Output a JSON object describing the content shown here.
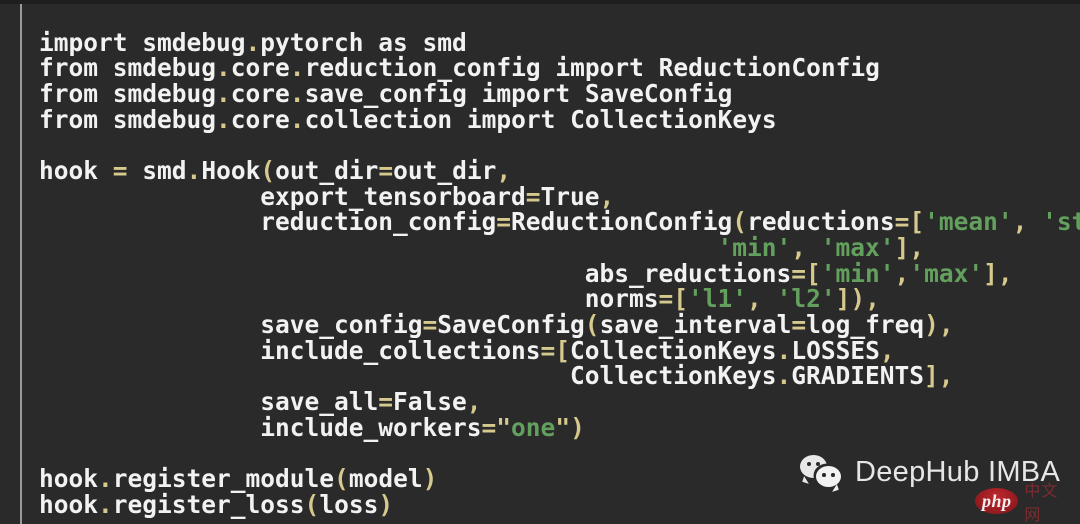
{
  "editor": {
    "background_color": "#2a2a2a",
    "text_color": "#f2f2f2",
    "punctuation_color": "#d5c98d",
    "string_color": "#63a05e",
    "rule_color": "#9a9a9a",
    "language": "python",
    "lines": [
      [
        {
          "t": "import smdebug",
          "c": "id"
        },
        {
          "t": ".",
          "c": "punc"
        },
        {
          "t": "pytorch as smd",
          "c": "id"
        }
      ],
      [
        {
          "t": "from smdebug",
          "c": "id"
        },
        {
          "t": ".",
          "c": "punc"
        },
        {
          "t": "core",
          "c": "id"
        },
        {
          "t": ".",
          "c": "punc"
        },
        {
          "t": "reduction_config import ReductionConfig",
          "c": "id"
        }
      ],
      [
        {
          "t": "from smdebug",
          "c": "id"
        },
        {
          "t": ".",
          "c": "punc"
        },
        {
          "t": "core",
          "c": "id"
        },
        {
          "t": ".",
          "c": "punc"
        },
        {
          "t": "save_config import SaveConfig",
          "c": "id"
        }
      ],
      [
        {
          "t": "from smdebug",
          "c": "id"
        },
        {
          "t": ".",
          "c": "punc"
        },
        {
          "t": "core",
          "c": "id"
        },
        {
          "t": ".",
          "c": "punc"
        },
        {
          "t": "collection import CollectionKeys",
          "c": "id"
        }
      ],
      [
        {
          "t": "",
          "c": "blank"
        }
      ],
      [
        {
          "t": "hook ",
          "c": "id"
        },
        {
          "t": "= ",
          "c": "punc"
        },
        {
          "t": "smd",
          "c": "id"
        },
        {
          "t": ".",
          "c": "punc"
        },
        {
          "t": "Hook",
          "c": "id"
        },
        {
          "t": "(",
          "c": "punc"
        },
        {
          "t": "out_dir",
          "c": "id"
        },
        {
          "t": "=",
          "c": "punc"
        },
        {
          "t": "out_dir",
          "c": "id"
        },
        {
          "t": ",",
          "c": "punc"
        }
      ],
      [
        {
          "t": "               export_tensorboard",
          "c": "id"
        },
        {
          "t": "=",
          "c": "punc"
        },
        {
          "t": "True",
          "c": "id"
        },
        {
          "t": ",",
          "c": "punc"
        }
      ],
      [
        {
          "t": "               reduction_config",
          "c": "id"
        },
        {
          "t": "=",
          "c": "punc"
        },
        {
          "t": "ReductionConfig",
          "c": "id"
        },
        {
          "t": "(",
          "c": "punc"
        },
        {
          "t": "reductions",
          "c": "id"
        },
        {
          "t": "=[",
          "c": "punc"
        },
        {
          "t": "'mean'",
          "c": "str"
        },
        {
          "t": ", ",
          "c": "punc"
        },
        {
          "t": "'std'",
          "c": "str"
        },
        {
          "t": ",",
          "c": "punc"
        }
      ],
      [
        {
          "t": "                                              ",
          "c": "blank"
        },
        {
          "t": "'min'",
          "c": "str"
        },
        {
          "t": ", ",
          "c": "punc"
        },
        {
          "t": "'max'",
          "c": "str"
        },
        {
          "t": "],",
          "c": "punc"
        }
      ],
      [
        {
          "t": "                                     abs_reductions",
          "c": "id"
        },
        {
          "t": "=[",
          "c": "punc"
        },
        {
          "t": "'min'",
          "c": "str"
        },
        {
          "t": ",",
          "c": "punc"
        },
        {
          "t": "'max'",
          "c": "str"
        },
        {
          "t": "],",
          "c": "punc"
        }
      ],
      [
        {
          "t": "                                     norms",
          "c": "id"
        },
        {
          "t": "=[",
          "c": "punc"
        },
        {
          "t": "'l1'",
          "c": "str"
        },
        {
          "t": ", ",
          "c": "punc"
        },
        {
          "t": "'l2'",
          "c": "str"
        },
        {
          "t": "]),",
          "c": "punc"
        }
      ],
      [
        {
          "t": "               save_config",
          "c": "id"
        },
        {
          "t": "=",
          "c": "punc"
        },
        {
          "t": "SaveConfig",
          "c": "id"
        },
        {
          "t": "(",
          "c": "punc"
        },
        {
          "t": "save_interval",
          "c": "id"
        },
        {
          "t": "=",
          "c": "punc"
        },
        {
          "t": "log_freq",
          "c": "id"
        },
        {
          "t": "),",
          "c": "punc"
        }
      ],
      [
        {
          "t": "               include_collections",
          "c": "id"
        },
        {
          "t": "=[",
          "c": "punc"
        },
        {
          "t": "CollectionKeys",
          "c": "id"
        },
        {
          "t": ".",
          "c": "punc"
        },
        {
          "t": "LOSSES",
          "c": "id"
        },
        {
          "t": ",",
          "c": "punc"
        }
      ],
      [
        {
          "t": "                                    CollectionKeys",
          "c": "id"
        },
        {
          "t": ".",
          "c": "punc"
        },
        {
          "t": "GRADIENTS",
          "c": "id"
        },
        {
          "t": "],",
          "c": "punc"
        }
      ],
      [
        {
          "t": "               save_all",
          "c": "id"
        },
        {
          "t": "=",
          "c": "punc"
        },
        {
          "t": "False",
          "c": "id"
        },
        {
          "t": ",",
          "c": "punc"
        }
      ],
      [
        {
          "t": "               include_workers",
          "c": "id"
        },
        {
          "t": "=",
          "c": "punc"
        },
        {
          "t": "\"",
          "c": "punc"
        },
        {
          "t": "one",
          "c": "str"
        },
        {
          "t": "\"",
          "c": "punc"
        },
        {
          "t": ")",
          "c": "punc"
        }
      ],
      [
        {
          "t": "",
          "c": "blank"
        }
      ],
      [
        {
          "t": "hook",
          "c": "id"
        },
        {
          "t": ".",
          "c": "punc"
        },
        {
          "t": "register_module",
          "c": "id"
        },
        {
          "t": "(",
          "c": "punc"
        },
        {
          "t": "model",
          "c": "id"
        },
        {
          "t": ")",
          "c": "punc"
        }
      ],
      [
        {
          "t": "hook",
          "c": "id"
        },
        {
          "t": ".",
          "c": "punc"
        },
        {
          "t": "register_loss",
          "c": "id"
        },
        {
          "t": "(",
          "c": "punc"
        },
        {
          "t": "loss",
          "c": "id"
        },
        {
          "t": ")",
          "c": "punc"
        }
      ]
    ],
    "plain_text": "import smdebug.pytorch as smd\nfrom smdebug.core.reduction_config import ReductionConfig\nfrom smdebug.core.save_config import SaveConfig\nfrom smdebug.core.collection import CollectionKeys\n\nhook = smd.Hook(out_dir=out_dir,\n               export_tensorboard=True,\n               reduction_config=ReductionConfig(reductions=['mean', 'std',\n                                              'min', 'max'],\n                                     abs_reductions=['min','max'],\n                                     norms=['l1', 'l2']),\n               save_config=SaveConfig(save_interval=log_freq),\n               include_collections=[CollectionKeys.LOSSES,\n                                    CollectionKeys.GRADIENTS],\n               save_all=False,\n               include_workers=\"one\")\n\nhook.register_module(model)\nhook.register_loss(loss)"
  },
  "watermark": {
    "brand": "DeepHub IMBA",
    "wechat_icon": "wechat-logo-icon",
    "badge_label": "php",
    "badge_suffix": "中文网",
    "badge_color": "#a81f24",
    "brand_color": "#e6e6e6"
  }
}
